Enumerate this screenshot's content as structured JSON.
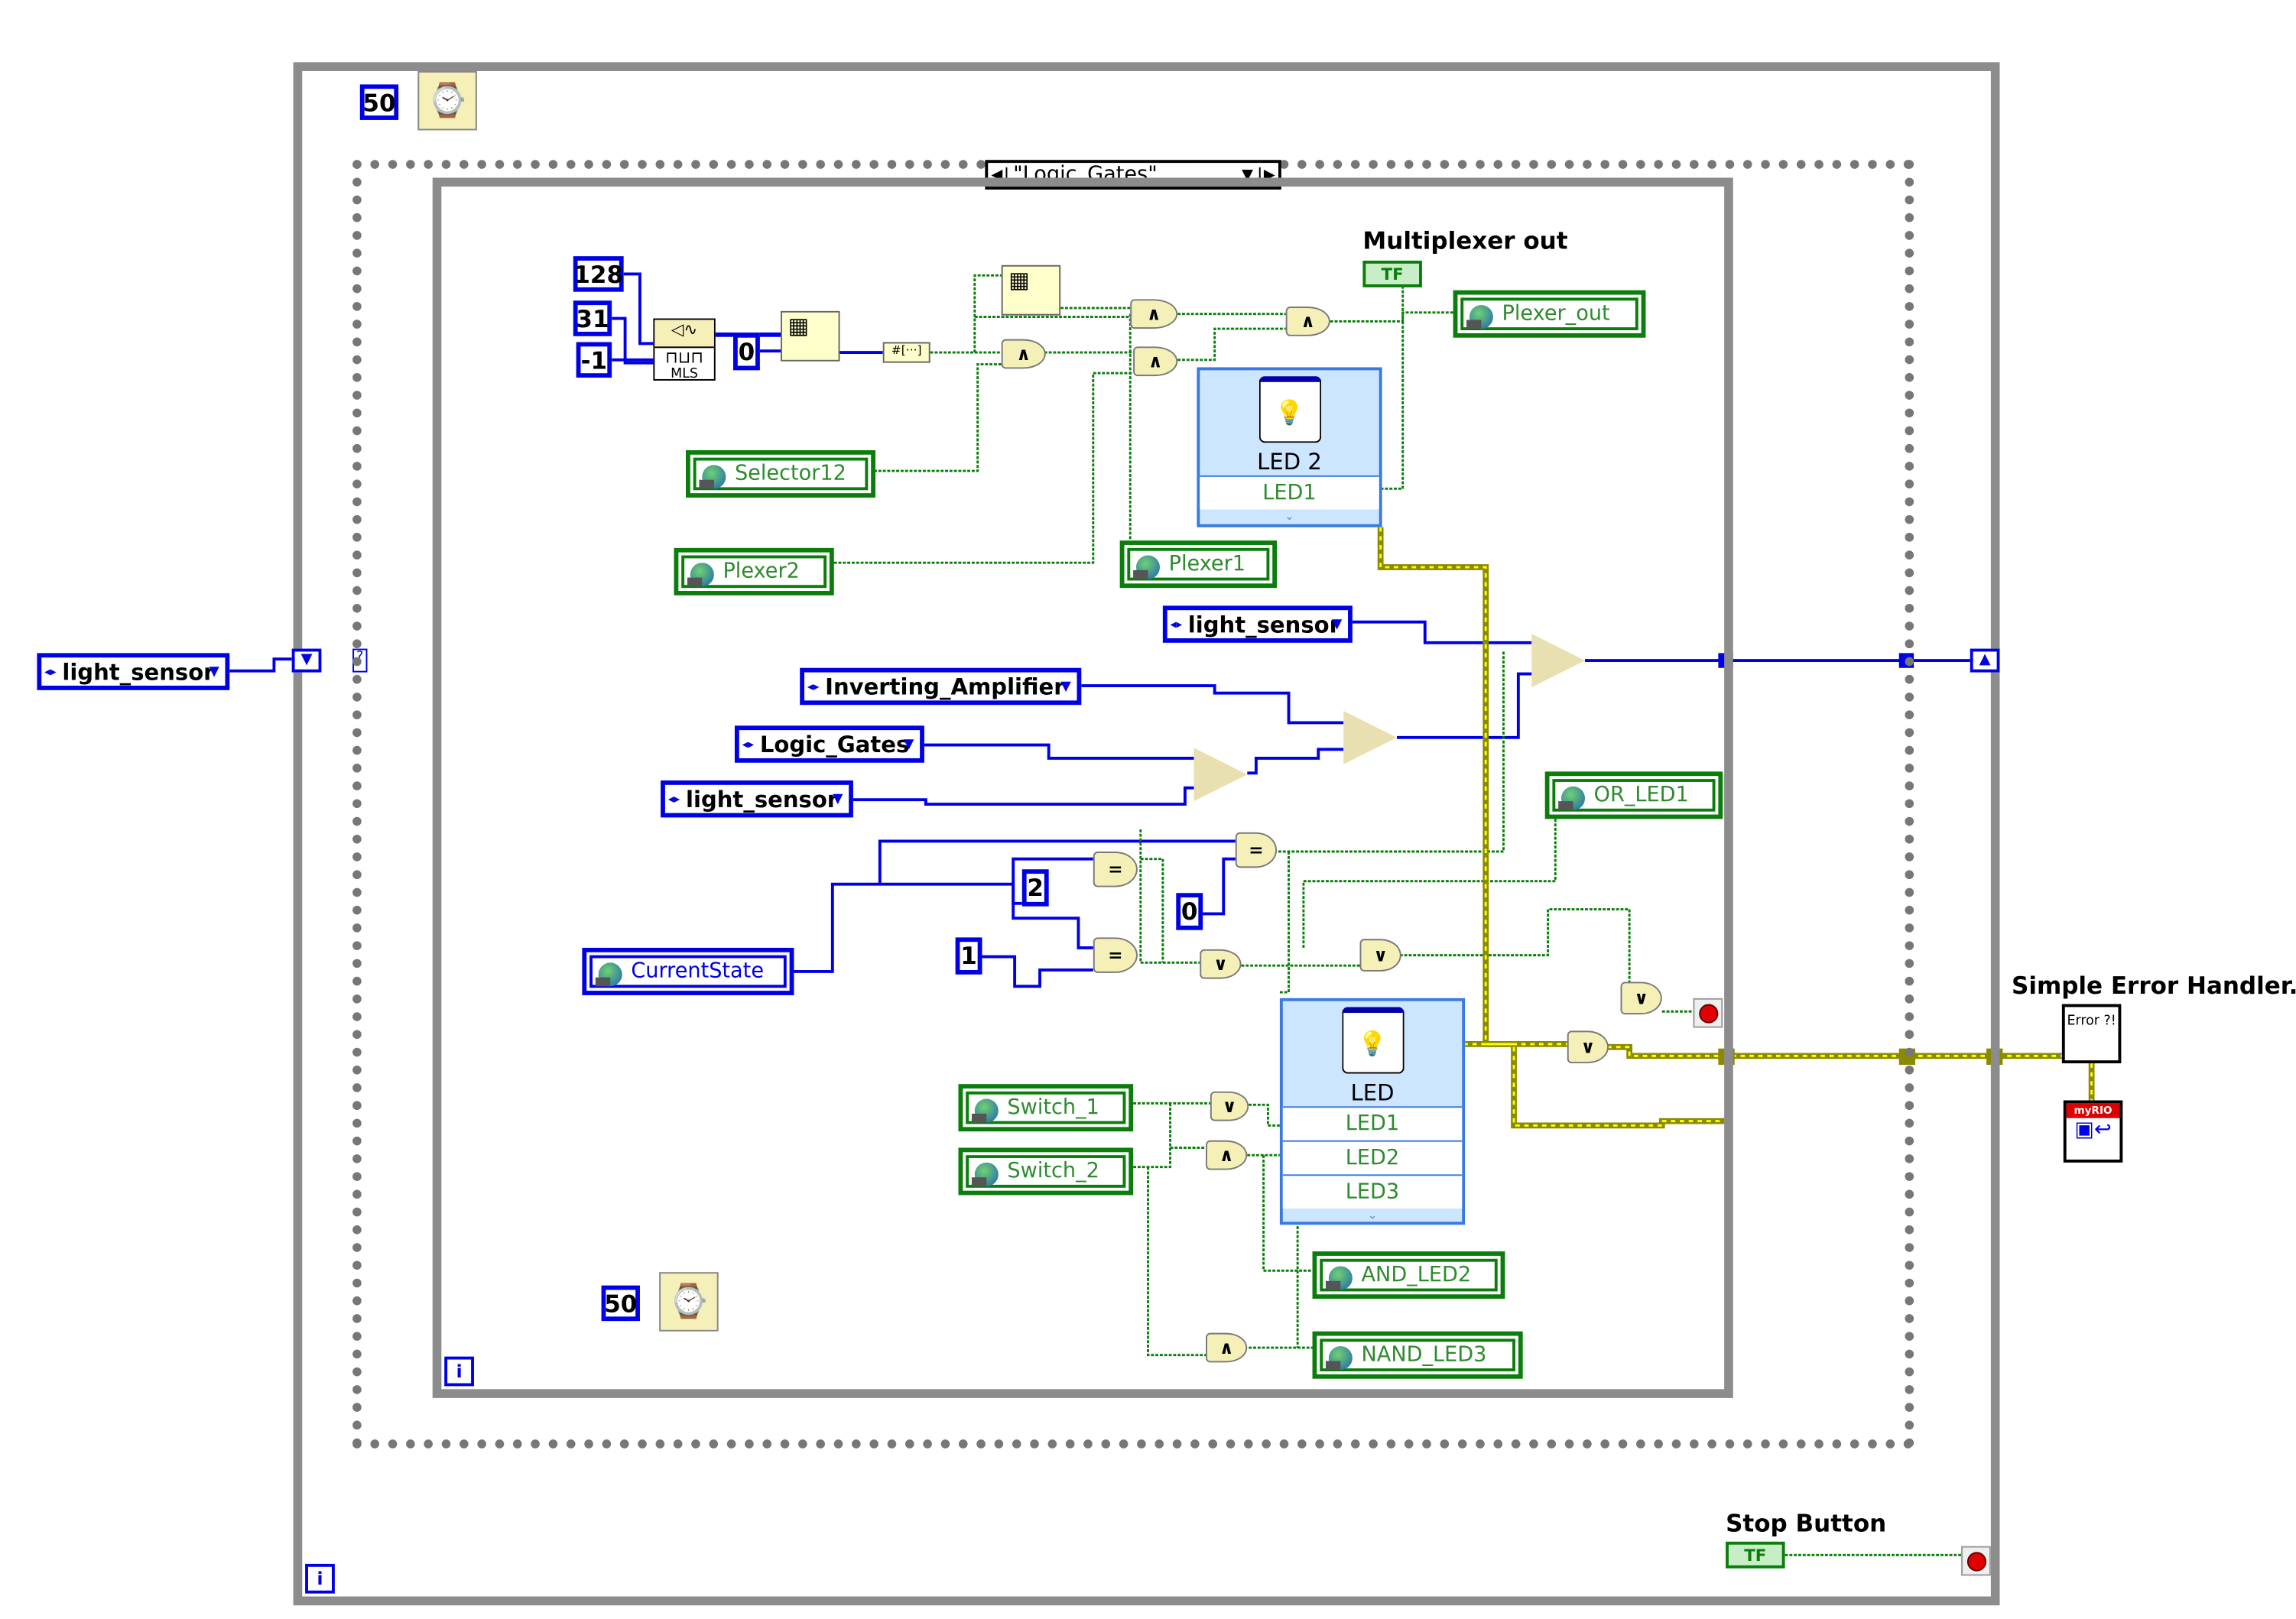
{
  "outer_loop": {
    "wait_ms": "50",
    "iteration_label": "i"
  },
  "case_structure": {
    "selector_value": "\"Logic_Gates\""
  },
  "inner_loop": {
    "wait_ms": "50",
    "iteration_label": "i"
  },
  "constants": {
    "c128": "128",
    "c31": "31",
    "cneg1": "-1",
    "c0a": "0",
    "c2": "2",
    "c0b": "0",
    "c1": "1"
  },
  "mls_label": "MLS",
  "gate_symbols": {
    "and": "∧",
    "or": "∨",
    "eq": "="
  },
  "labels": {
    "multiplexer_out": "Multiplexer out",
    "simple_error_handler": "Simple Error Handler.vi",
    "stop_button": "Stop Button",
    "tf": "TF"
  },
  "shared_variables": {
    "plexer_out": "Plexer_out",
    "selector12": "Selector12",
    "plexer2": "Plexer2",
    "plexer1": "Plexer1",
    "or_led1": "OR_LED1",
    "current_state": "CurrentState",
    "switch_1": "Switch_1",
    "switch_2": "Switch_2",
    "and_led2": "AND_LED2",
    "nand_led3": "NAND_LED3"
  },
  "enums": {
    "outer_light_sensor": "light_sensor",
    "light_sensor_top": "light_sensor",
    "inverting_amplifier": "Inverting_Amplifier",
    "logic_gates": "Logic_Gates",
    "light_sensor_bottom": "light_sensor"
  },
  "led2_node": {
    "title": "LED 2",
    "rows": [
      "LED1"
    ]
  },
  "led_node": {
    "title": "LED",
    "rows": [
      "LED1",
      "LED2",
      "LED3"
    ]
  },
  "error_handler": {
    "icon_text": "Error ?!"
  },
  "myrio_node": {
    "banner": "myRIO"
  },
  "colors": {
    "enum_wire": "#0000e6",
    "bool_wire": "#0a7d0a",
    "error_wire": "#8a8a00",
    "loop": "#8c8c8c"
  }
}
